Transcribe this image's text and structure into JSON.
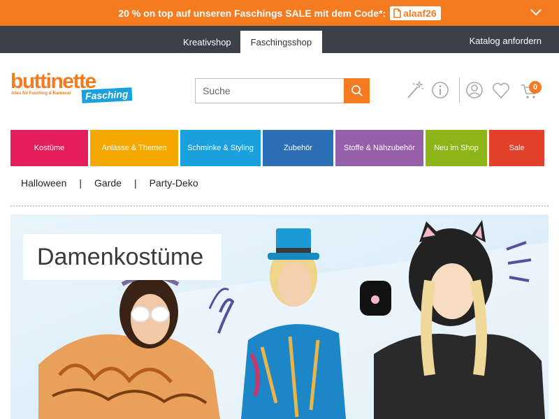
{
  "promo": {
    "text": "20 % on top auf unseren Faschings SALE mit dem Code*:",
    "code": "alaaf26",
    "icons": {
      "code": "document-icon",
      "toggle": "chevron-down-icon"
    }
  },
  "shop_tabs": [
    {
      "label": "Kreativshop",
      "active": false
    },
    {
      "label": "Faschingsshop",
      "active": true
    }
  ],
  "catalog_link": "Katalog anfordern",
  "logo": {
    "brand": "buttinette",
    "tagline": "Alles für Fasching & Karneval",
    "badge": "Fasching"
  },
  "search": {
    "placeholder": "Suche",
    "icon": "search-icon"
  },
  "header_icons": [
    "magic-wand-icon",
    "info-icon",
    "user-icon",
    "heart-icon",
    "cart-icon"
  ],
  "cart_count": "0",
  "categories": [
    {
      "label": "Kostüme",
      "color": "#e31e5a"
    },
    {
      "label": "Anlässe & Themen",
      "color": "#f5a800"
    },
    {
      "label": "Schminke & Styling",
      "color": "#1aa0dc"
    },
    {
      "label": "Zubehör",
      "color": "#2c6fb5"
    },
    {
      "label": "Stoffe & Nähzubehör",
      "color": "#955faa"
    },
    {
      "label": "Neu im Shop",
      "color": "#8db419"
    },
    {
      "label": "Sale",
      "color": "#e2402b"
    }
  ],
  "subnav": [
    "Halloween",
    "Garde",
    "Party-Deko"
  ],
  "banner": {
    "title": "Damenkostüme"
  },
  "colors": {
    "accent": "#f47b20",
    "topbar": "#3b4049",
    "fasching_blue": "#1aa0dc"
  }
}
